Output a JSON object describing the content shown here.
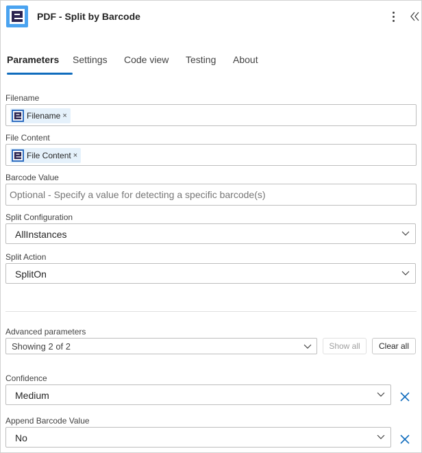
{
  "header": {
    "title": "PDF - Split by Barcode",
    "app_icon": "encodian-logo-icon",
    "more_icon": "more-vertical-icon",
    "collapse_icon": "double-chevron-left-icon"
  },
  "tabs": [
    {
      "label": "Parameters",
      "active": true
    },
    {
      "label": "Settings",
      "active": false
    },
    {
      "label": "Code view",
      "active": false
    },
    {
      "label": "Testing",
      "active": false
    },
    {
      "label": "About",
      "active": false
    }
  ],
  "fields": {
    "filename": {
      "label": "Filename",
      "token": "Filename",
      "token_remove": "×"
    },
    "file_content": {
      "label": "File Content",
      "token": "File Content",
      "token_remove": "×"
    },
    "barcode_value": {
      "label": "Barcode Value",
      "placeholder": "Optional - Specify a value for detecting a specific barcode(s)"
    },
    "split_configuration": {
      "label": "Split Configuration",
      "value": "AllInstances"
    },
    "split_action": {
      "label": "Split Action",
      "value": "SplitOn"
    }
  },
  "advanced": {
    "label": "Advanced parameters",
    "value": "Showing 2 of 2",
    "show_all": "Show all",
    "clear_all": "Clear all"
  },
  "advanced_fields": {
    "confidence": {
      "label": "Confidence",
      "value": "Medium"
    },
    "append_barcode_value": {
      "label": "Append Barcode Value",
      "value": "No"
    }
  },
  "colors": {
    "accent": "#0f6cbd",
    "app_icon_bg": "#4aa3f0",
    "token_bg": "#e5f1fb"
  }
}
